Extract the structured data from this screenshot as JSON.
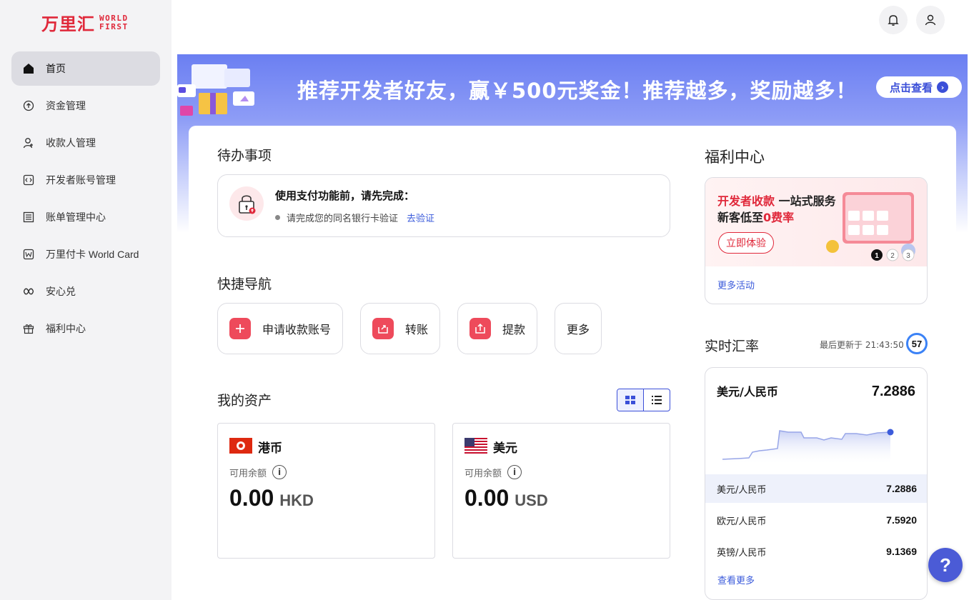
{
  "brand": {
    "name_cn": "万里汇",
    "name_en_line1": "WORLD",
    "name_en_line2": "FIRST",
    "color": "#e0283a"
  },
  "sidebar": {
    "items": [
      {
        "label": "首页",
        "icon": "home-icon",
        "active": true
      },
      {
        "label": "资金管理",
        "icon": "fund-icon"
      },
      {
        "label": "收款人管理",
        "icon": "payee-icon"
      },
      {
        "label": "开发者账号管理",
        "icon": "developer-icon"
      },
      {
        "label": "账单管理中心",
        "icon": "bill-icon"
      },
      {
        "label": "万里付卡 World Card",
        "icon": "card-icon"
      },
      {
        "label": "安心兑",
        "icon": "exchange-icon"
      },
      {
        "label": "福利中心",
        "icon": "gift-icon"
      }
    ]
  },
  "header": {
    "bell_icon": "bell-icon",
    "user_icon": "user-icon"
  },
  "banner": {
    "title": "推荐开发者好友，赢￥500元奖金！推荐越多，奖励越多！",
    "button": "点击查看"
  },
  "todo": {
    "section_title": "待办事项",
    "title": "使用支付功能前，请先完成：",
    "item": "请完成您的同名银行卡验证",
    "link": "去验证"
  },
  "quick_nav": {
    "section_title": "快捷导航",
    "items": [
      {
        "label": "申请收款账号",
        "icon": "plus-icon"
      },
      {
        "label": "转账",
        "icon": "transfer-icon"
      },
      {
        "label": "提款",
        "icon": "withdraw-icon"
      },
      {
        "label": "更多"
      }
    ]
  },
  "assets": {
    "section_title": "我的资产",
    "accounts": [
      {
        "name": "港币",
        "available_label": "可用余额",
        "amount": "0.00",
        "code": "HKD",
        "flag": "hk-flag-icon"
      },
      {
        "name": "美元",
        "available_label": "可用余额",
        "amount": "0.00",
        "code": "USD",
        "flag": "us-flag-icon"
      }
    ]
  },
  "welfare": {
    "section_title": "福利中心",
    "line1_red": "开发者收款",
    "line1_rest": " 一站式服务",
    "line2_prefix": "新客低至",
    "line2_red": "0费率",
    "button": "立即体验",
    "more": "更多活动",
    "steps": [
      "1",
      "2",
      "3"
    ]
  },
  "rates": {
    "section_title": "实时汇率",
    "updated": "最后更新于 21:43:50",
    "countdown": "57",
    "selected_pair": "美元/人民币",
    "selected_value": "7.2886",
    "rows": [
      {
        "pair": "美元/人民币",
        "value": "7.2886"
      },
      {
        "pair": "欧元/人民币",
        "value": "7.5920"
      },
      {
        "pair": "英镑/人民币",
        "value": "9.1369"
      }
    ],
    "more": "查看更多"
  },
  "help": "?",
  "colors": {
    "accent": "#3b4fd8",
    "red": "#ee4a5b",
    "banner": "#6b7ff2"
  }
}
